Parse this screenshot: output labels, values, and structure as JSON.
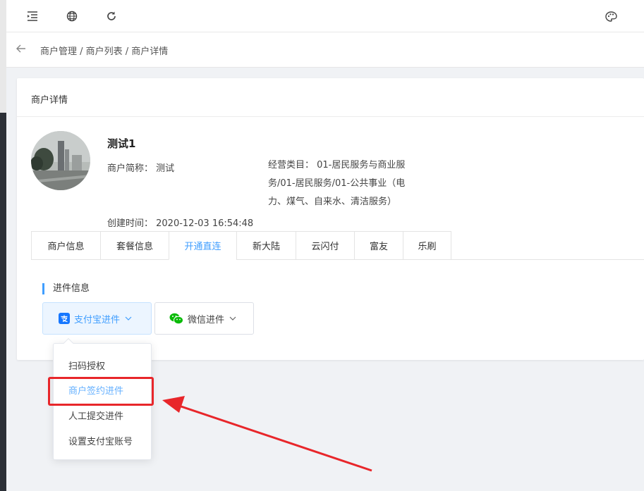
{
  "topbar": {
    "icons": [
      "menu-fold-icon",
      "globe-icon",
      "refresh-icon",
      "palette-icon"
    ]
  },
  "breadcrumb": {
    "text": "商户管理 / 商户列表 / 商户详情"
  },
  "card": {
    "title": "商户详情"
  },
  "merchant": {
    "name": "测试1",
    "short_name": "商户简称： 测试",
    "category": "经营类目： 01-居民服务与商业服务/01-居民服务/01-公共事业（电力、煤气、自来水、清洁服务）",
    "created": "创建时间： 2020-12-03 16:54:48"
  },
  "tabs": [
    {
      "label": "商户信息",
      "active": false
    },
    {
      "label": "套餐信息",
      "active": false
    },
    {
      "label": "开通直连",
      "active": true
    },
    {
      "label": "新大陆",
      "active": false
    },
    {
      "label": "云闪付",
      "active": false
    },
    {
      "label": "富友",
      "active": false
    },
    {
      "label": "乐刷",
      "active": false
    }
  ],
  "section": {
    "title": "进件信息"
  },
  "buttons": {
    "alipay_label": "支付宝进件",
    "wechat_label": "微信进件"
  },
  "dropdown": {
    "items": [
      "扫码授权",
      "商户签约进件",
      "人工提交进件",
      "设置支付宝账号"
    ],
    "highlighted_index": 1
  },
  "colors": {
    "accent": "#409eff",
    "annotation_red": "#e8262a",
    "wechat_green": "#09bb07"
  }
}
